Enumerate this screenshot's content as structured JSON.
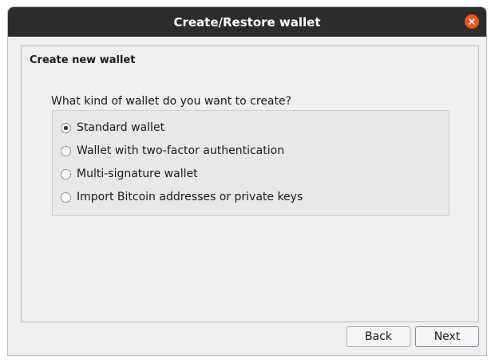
{
  "window": {
    "title": "Create/Restore wallet"
  },
  "page": {
    "heading": "Create new wallet",
    "question": "What kind of wallet do you want to create?",
    "options": [
      {
        "label": "Standard wallet",
        "selected": true
      },
      {
        "label": "Wallet with two-factor authentication",
        "selected": false
      },
      {
        "label": "Multi-signature wallet",
        "selected": false
      },
      {
        "label": "Import Bitcoin addresses or private keys",
        "selected": false
      }
    ]
  },
  "buttons": {
    "back": "Back",
    "next": "Next"
  },
  "colors": {
    "titlebar": "#2c2c2c",
    "close_button": "#e95420",
    "background": "#efefef"
  },
  "icons": {
    "close": "close-icon"
  }
}
